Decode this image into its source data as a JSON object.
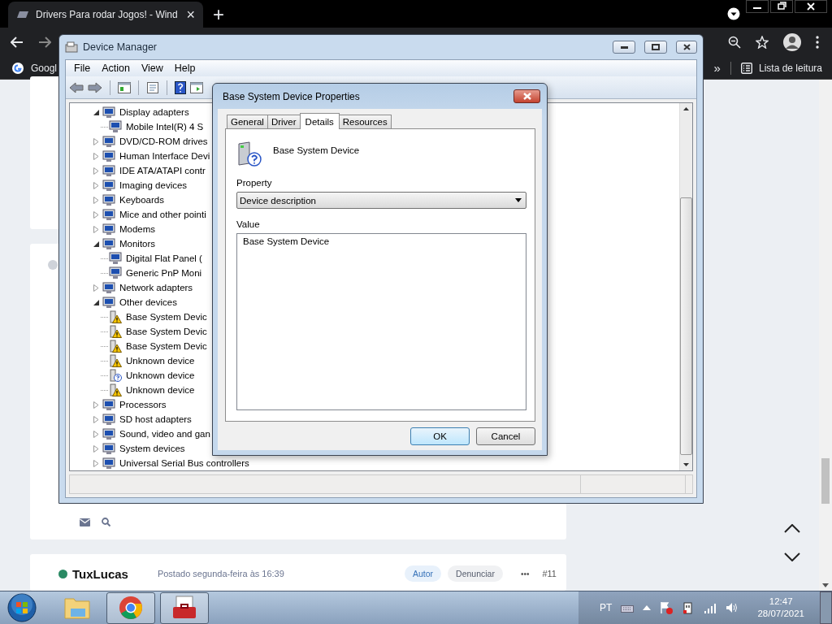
{
  "browser": {
    "tab": {
      "title": "Drivers Para rodar Jogos! - Wind",
      "close": "×"
    },
    "new_tab": "+",
    "bookmarks": [
      {
        "label": "Googl"
      }
    ],
    "overflow": "»",
    "reading_list": "Lista de leitura"
  },
  "page": {
    "post": {
      "author": "TuxLucas",
      "online": true,
      "meta": "Postado segunda-feira às 16:39",
      "badges": [
        {
          "label": "Autor",
          "kind": "author"
        },
        {
          "label": "Denunciar",
          "kind": "report"
        }
      ],
      "more": "•••",
      "number": "#11"
    }
  },
  "device_manager": {
    "title": "Device Manager",
    "menu": [
      "File",
      "Action",
      "View",
      "Help"
    ],
    "tree": [
      {
        "label": "Display adapters",
        "expanded": true,
        "children": [
          {
            "label": "Mobile Intel(R) 4 S"
          }
        ]
      },
      {
        "label": "DVD/CD-ROM drives",
        "expanded": false
      },
      {
        "label": "Human Interface Devi",
        "expanded": false
      },
      {
        "label": "IDE ATA/ATAPI contr",
        "expanded": false
      },
      {
        "label": "Imaging devices",
        "expanded": false
      },
      {
        "label": "Keyboards",
        "expanded": false
      },
      {
        "label": "Mice and other pointi",
        "expanded": false
      },
      {
        "label": "Modems",
        "expanded": false
      },
      {
        "label": "Monitors",
        "expanded": true,
        "children": [
          {
            "label": "Digital Flat Panel ("
          },
          {
            "label": "Generic PnP Moni"
          }
        ]
      },
      {
        "label": "Network adapters",
        "expanded": false
      },
      {
        "label": "Other devices",
        "expanded": true,
        "children": [
          {
            "label": "Base System Devic",
            "kind": "warning"
          },
          {
            "label": "Base System Devic",
            "kind": "warning"
          },
          {
            "label": "Base System Devic",
            "kind": "warning"
          },
          {
            "label": "Unknown device",
            "kind": "warning"
          },
          {
            "label": "Unknown device",
            "kind": "unknown"
          },
          {
            "label": "Unknown device",
            "kind": "warning"
          }
        ]
      },
      {
        "label": "Processors",
        "expanded": false
      },
      {
        "label": "SD host adapters",
        "expanded": false
      },
      {
        "label": "Sound, video and gan",
        "expanded": false
      },
      {
        "label": "System devices",
        "expanded": false
      },
      {
        "label": "Universal Serial Bus controllers",
        "expanded": false
      }
    ]
  },
  "dialog": {
    "title": "Base System Device Properties",
    "tabs": [
      {
        "label": "General",
        "selected": false
      },
      {
        "label": "Driver",
        "selected": false
      },
      {
        "label": "Details",
        "selected": true
      },
      {
        "label": "Resources",
        "selected": false
      }
    ],
    "device_name": "Base System Device",
    "property_label": "Property",
    "property_value": "Device description",
    "value_label": "Value",
    "values": [
      "Base System Device"
    ],
    "buttons": [
      {
        "label": "OK",
        "default": true
      },
      {
        "label": "Cancel",
        "default": false
      }
    ]
  },
  "taskbar": {
    "apps": [
      {
        "kind": "explorer",
        "active": false
      },
      {
        "kind": "chrome",
        "active": true
      },
      {
        "kind": "toolbox",
        "active": true
      }
    ],
    "language": "PT",
    "time": "12:47",
    "date": "28/07/2021"
  }
}
